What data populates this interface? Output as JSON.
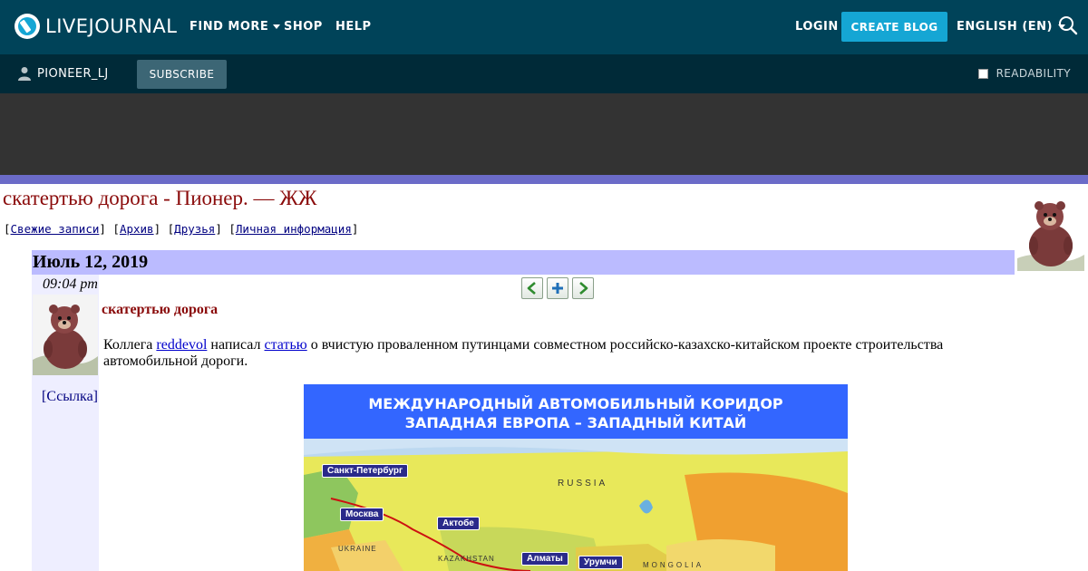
{
  "topbar": {
    "logo_text": "LIVEJOURNAL",
    "find_more": "FIND MORE",
    "shop": "SHOP",
    "help": "HELP",
    "login": "LOGIN",
    "create_blog": "CREATE BLOG",
    "language": "ENGLISH (EN)"
  },
  "subbar": {
    "username": "PIONEER_LJ",
    "subscribe": "SUBSCRIBE",
    "readability": "READABILITY"
  },
  "journal": {
    "title": "скатертью дорога - Пионер. — ЖЖ",
    "nav": [
      "Свежие записи",
      "Архив",
      "Друзья",
      "Личная информация"
    ]
  },
  "post": {
    "date": "Июль 12, 2019",
    "time": "09:04 pm",
    "link_label": "[Ссылка]",
    "subject": "скатертью дорога",
    "body_pre": "Коллега ",
    "body_link1": "reddevol",
    "body_mid": " написал ",
    "body_link2": "статью",
    "body_post": " о вчистую проваленном путинцами совместном российско-казахско-китайском проекте строительства автомобильной дороги."
  },
  "map": {
    "title_line1": "МЕЖДУНАРОДНЫЙ АВТОМОБИЛЬНЫЙ КОРИДОР",
    "title_line2": "ЗАПАДНАЯ ЕВРОПА – ЗАПАДНЫЙ КИТАЙ",
    "cities": [
      "Санкт-Петербург",
      "Москва",
      "Актобе",
      "Алматы",
      "Урумчи"
    ],
    "labels": [
      "RUSSIA",
      "MONGOLIA",
      "KAZAKHSTAN",
      "UKRAINE"
    ]
  },
  "colors": {
    "topbar": "#004359",
    "subbar": "#002a38",
    "accent": "#15a6d4",
    "strip": "#6b6bc8",
    "date_row": "#bbbbff",
    "title_red": "#8a0a0a"
  }
}
